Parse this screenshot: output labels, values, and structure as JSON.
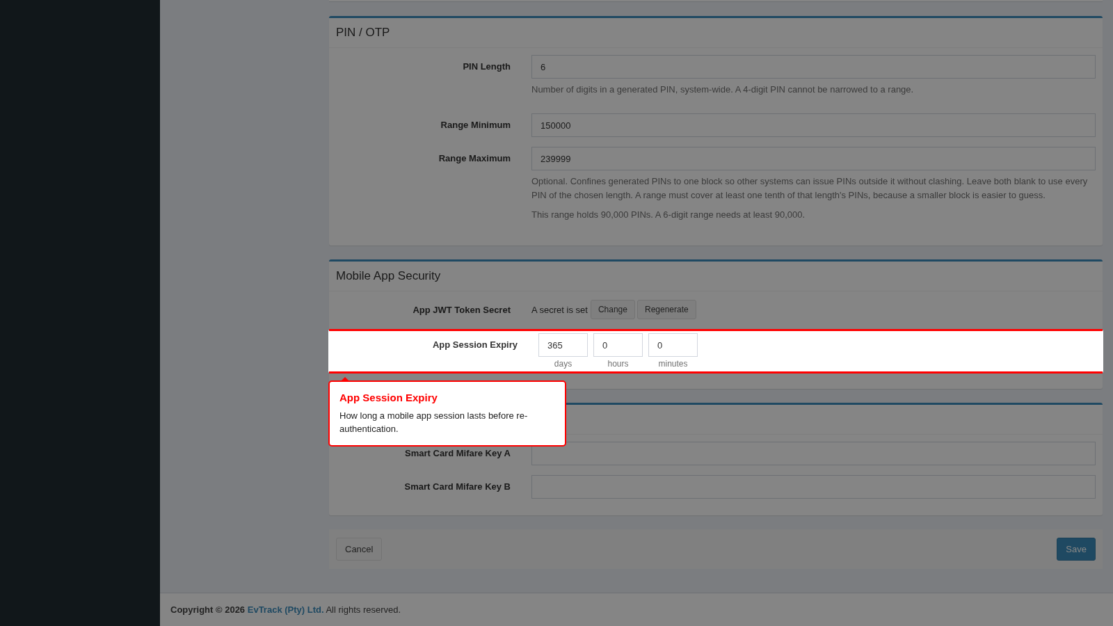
{
  "sections": [
    {
      "title": "PIN / OTP",
      "fields": [
        {
          "kind": "text",
          "label": "PIN Length",
          "value": "6",
          "help": [
            "Number of digits in a generated PIN, system-wide. A 4-digit PIN cannot be narrowed to a range."
          ]
        },
        {
          "kind": "text",
          "label": "Range Minimum",
          "value": "150000"
        },
        {
          "kind": "text",
          "label": "Range Maximum",
          "value": "239999",
          "help": [
            "Optional. Confines generated PINs to one block so other systems can issue PINs outside it without clashing. Leave both blank to use every PIN of the chosen length. A range must cover at least one tenth of that length's PINs, because a smaller block is easier to guess.",
            "This range holds 90,000 PINs. A 6-digit range needs at least 90,000."
          ]
        }
      ]
    },
    {
      "title": "Mobile App Security",
      "fields": [
        {
          "kind": "secret",
          "label": "App JWT Token Secret",
          "status": "A secret is set",
          "buttons": [
            "Change",
            "Regenerate"
          ]
        },
        {
          "kind": "duration",
          "label": "App Session Expiry",
          "highlighted": true,
          "parts": [
            {
              "value": "365",
              "unit": "days"
            },
            {
              "value": "0",
              "unit": "hours"
            },
            {
              "value": "0",
              "unit": "minutes"
            }
          ]
        }
      ]
    },
    {
      "fields": [
        {
          "kind": "text",
          "label": "Smart Card Mifare Key A"
        },
        {
          "kind": "text",
          "label": "Smart Card Mifare Key B"
        }
      ]
    }
  ],
  "tooltip": {
    "title": "App Session Expiry",
    "body": "How long a mobile app session lasts before re-authentication."
  },
  "actions": {
    "cancel": "Cancel",
    "save": "Save"
  },
  "footer": {
    "prefix": "Copyright © 2026",
    "company": "EvTrack (Pty) Ltd.",
    "suffix": "All rights reserved."
  }
}
